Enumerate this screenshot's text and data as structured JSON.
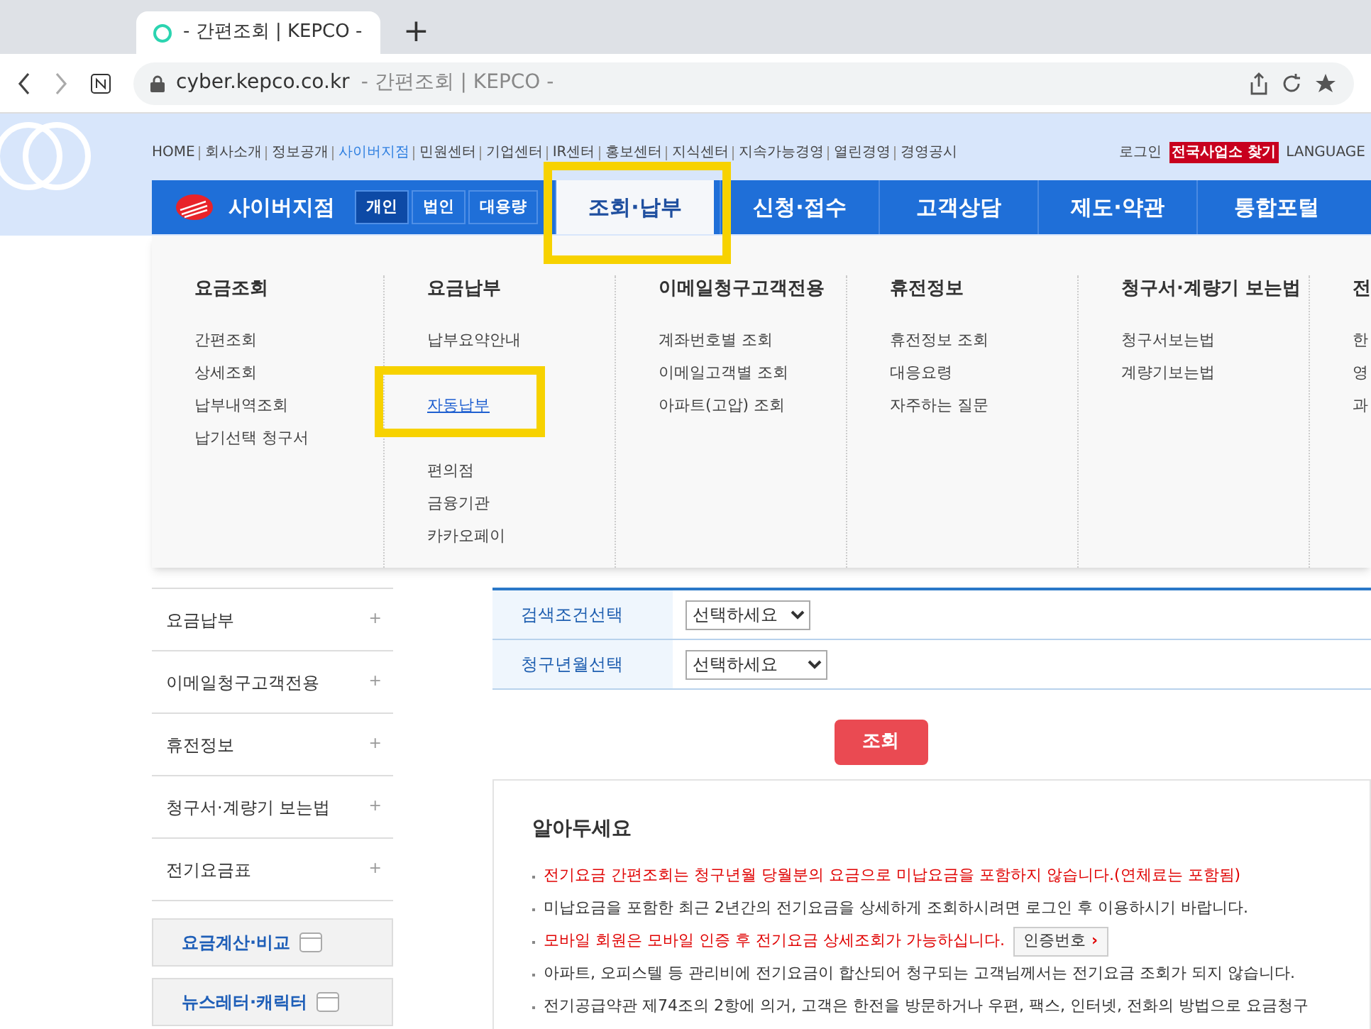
{
  "browser": {
    "tab_title": "- 간편조회 | KEPCO -",
    "new_tab": "+",
    "url_host": "cyber.kepco.co.kr",
    "url_title": "- 간편조회 | KEPCO -"
  },
  "top_links": [
    {
      "label": "HOME",
      "selected": false
    },
    {
      "label": "회사소개",
      "selected": false
    },
    {
      "label": "정보공개",
      "selected": false
    },
    {
      "label": "사이버지점",
      "selected": true
    },
    {
      "label": "민원센터",
      "selected": false
    },
    {
      "label": "기업센터",
      "selected": false
    },
    {
      "label": "IR센터",
      "selected": false
    },
    {
      "label": "홍보센터",
      "selected": false
    },
    {
      "label": "지식센터",
      "selected": false
    },
    {
      "label": "지속가능경영",
      "selected": false
    },
    {
      "label": "열린경영",
      "selected": false
    },
    {
      "label": "경영공시",
      "selected": false
    }
  ],
  "utility_links": [
    {
      "label": "로그인",
      "kind": "plain"
    },
    {
      "label": "전국사업소 찾기",
      "kind": "highlight"
    },
    {
      "label": "LANGUAGE",
      "kind": "plain"
    }
  ],
  "brand": "사이버지점",
  "customer_types": [
    {
      "label": "개인",
      "selected": true
    },
    {
      "label": "법인",
      "selected": false
    },
    {
      "label": "대용량",
      "selected": false
    }
  ],
  "main_nav": [
    {
      "label": "조회·납부",
      "selected": true,
      "highlighted": true
    },
    {
      "label": "신청·접수",
      "selected": false,
      "highlighted": false
    },
    {
      "label": "고객상담",
      "selected": false,
      "highlighted": false
    },
    {
      "label": "제도·약관",
      "selected": false,
      "highlighted": false
    },
    {
      "label": "통합포털",
      "selected": false,
      "highlighted": false
    }
  ],
  "mega_menu": [
    {
      "heading": "요금조회",
      "items": [
        {
          "label": "간편조회",
          "highlighted": false
        },
        {
          "label": "상세조회",
          "highlighted": false
        },
        {
          "label": "납부내역조회",
          "highlighted": false
        },
        {
          "label": "납기선택 청구서",
          "highlighted": false
        }
      ]
    },
    {
      "heading": "요금납부",
      "items": [
        {
          "label": "납부요약안내",
          "highlighted": false
        },
        {
          "label": "자동납부",
          "highlighted": true
        },
        {
          "label": "편의점",
          "highlighted": false
        },
        {
          "label": "금융기관",
          "highlighted": false
        },
        {
          "label": "카카오페이",
          "highlighted": false
        }
      ]
    },
    {
      "heading": "이메일청구고객전용",
      "items": [
        {
          "label": "계좌번호별 조회",
          "highlighted": false
        },
        {
          "label": "이메일고객별 조회",
          "highlighted": false
        },
        {
          "label": "아파트(고압) 조회",
          "highlighted": false
        }
      ]
    },
    {
      "heading": "휴전정보",
      "items": [
        {
          "label": "휴전정보 조회",
          "highlighted": false
        },
        {
          "label": "대응요령",
          "highlighted": false
        },
        {
          "label": "자주하는 질문",
          "highlighted": false
        }
      ]
    },
    {
      "heading": "청구서·계량기 보는법",
      "items": [
        {
          "label": "청구서보는법",
          "highlighted": false
        },
        {
          "label": "계량기보는법",
          "highlighted": false
        }
      ]
    },
    {
      "heading": "전",
      "items": [
        {
          "label": "한",
          "highlighted": false
        },
        {
          "label": "영",
          "highlighted": false
        },
        {
          "label": "과",
          "highlighted": false
        }
      ]
    }
  ],
  "sidebar": {
    "items": [
      {
        "label": "요금납부",
        "toggle": "+"
      },
      {
        "label": "이메일청구고객전용",
        "toggle": "+"
      },
      {
        "label": "휴전정보",
        "toggle": "+"
      },
      {
        "label": "청구서·계량기 보는법",
        "toggle": "+"
      },
      {
        "label": "전기요금표",
        "toggle": "+"
      }
    ],
    "banners": [
      "요금계산·비교",
      "뉴스레터·캐릭터"
    ]
  },
  "form": {
    "rows": [
      {
        "label": "검색조건선택",
        "value": "선택하세요"
      },
      {
        "label": "청구년월선택",
        "value": "선택하세요"
      }
    ],
    "submit": "조회"
  },
  "notice": {
    "title": "알아두세요",
    "items": [
      {
        "text": "전기요금 간편조회는 청구년월 당월분의 요금으로 미납요금을 포함하지 않습니다.(연체료는 포함됨)",
        "important": true
      },
      {
        "text": "미납요금을 포함한 최근 2년간의 전기요금을 상세하게 조회하시려면 로그인 후 이용하시기 바랍니다.",
        "important": false
      },
      {
        "text": "모바일 회원은 모바일 인증 후 전기요금 상세조회가 가능하십니다.",
        "important": true,
        "button": "인증번호",
        "button_icon": "›"
      },
      {
        "text": "아파트, 오피스텔 등 관리비에 전기요금이 합산되어 청구되는 고객님께서는 전기요금 조회가 되지 않습니다.",
        "important": false
      },
      {
        "text": "전기공급약관 제74조의 2항에 의거, 고객은 한전을 방문하거나 우편, 팩스, 인터넷, 전화의 방법으로 요금청구",
        "important": false
      }
    ]
  }
}
